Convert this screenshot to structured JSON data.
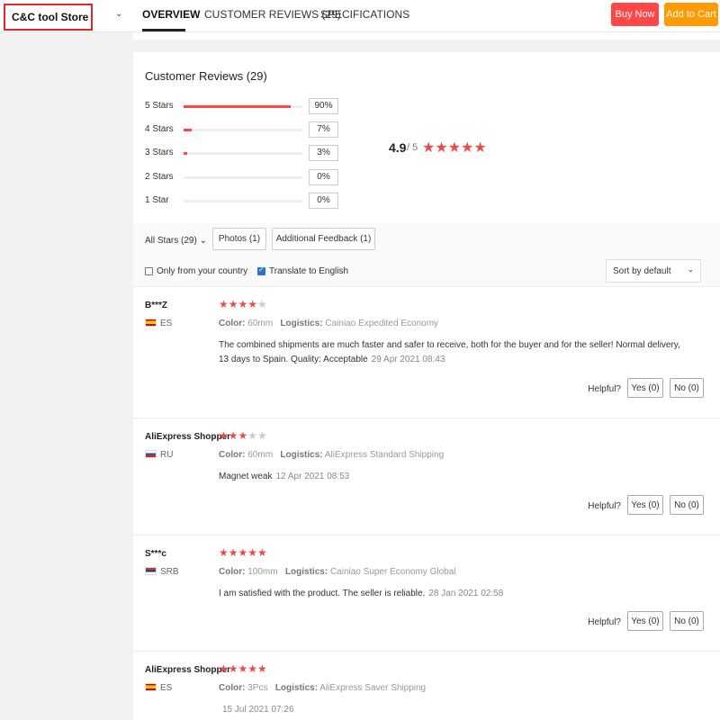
{
  "header": {
    "store_name": "C&C tool Store",
    "tabs": [
      {
        "label": "OVERVIEW"
      },
      {
        "label": "CUSTOMER REVIEWS (29)"
      },
      {
        "label": "SPECIFICATIONS"
      }
    ],
    "buy_now": "Buy Now",
    "add_to_cart": "Add to Cart",
    "colors": {
      "buy": "#ff4747",
      "cart": "#ff9a00"
    }
  },
  "summary": {
    "title": "Customer Reviews (29)",
    "rows": [
      {
        "label": "5 Stars",
        "percent": "90%",
        "fill": 0.9
      },
      {
        "label": "4 Stars",
        "percent": "7%",
        "fill": 0.07
      },
      {
        "label": "3 Stars",
        "percent": "3%",
        "fill": 0.03
      },
      {
        "label": "2 Stars",
        "percent": "0%",
        "fill": 0
      },
      {
        "label": "1 Star",
        "percent": "0%",
        "fill": 0
      }
    ],
    "score": "4.9",
    "score_max": "/ 5",
    "score_stars": "★★★★★"
  },
  "filters": {
    "all_stars": "All Stars (29)",
    "photos": "Photos (1)",
    "additional": "Additional Feedback (1)",
    "only_country": "Only from your country",
    "translate": "Translate to English",
    "sort": "Sort by default"
  },
  "reviews": [
    {
      "name": "B***Z",
      "stars_on": "★★★★",
      "stars_off": "★",
      "country": "ES",
      "color_key": "Color:",
      "color_val": "60mm",
      "log_key": "Logistics:",
      "log_val": "Cainiao Expedited Economy",
      "text": "The combined shipments are much faster and safer to receive, both for the buyer and for the seller! Normal delivery, 13 days to Spain. Quality: Acceptable",
      "date": "29 Apr 2021 08:43",
      "helpful": "Helpful?",
      "yes": "Yes (0)",
      "no": "No (0)"
    },
    {
      "name": "AliExpress Shopper",
      "stars_on": "★★★",
      "stars_off": "★★",
      "country": "RU",
      "color_key": "Color:",
      "color_val": "60mm",
      "log_key": "Logistics:",
      "log_val": "AliExpress Standard Shipping",
      "text": "Magnet weak",
      "date": "12 Apr 2021 08:53",
      "helpful": "Helpful?",
      "yes": "Yes (0)",
      "no": "No (0)"
    },
    {
      "name": "S***c",
      "stars_on": "★★★★★",
      "stars_off": "",
      "country": "SRB",
      "color_key": "Color:",
      "color_val": "100mm",
      "log_key": "Logistics:",
      "log_val": "Cainiao Super Economy Global",
      "text": "I am satisfied with the product. The seller is reliable.",
      "date": "28 Jan 2021 02:58",
      "helpful": "Helpful?",
      "yes": "Yes (0)",
      "no": "No (0)"
    },
    {
      "name": "AliExpress Shopper",
      "stars_on": "★★★★★",
      "stars_off": "",
      "country": "ES",
      "color_key": "Color:",
      "color_val": "3Pcs",
      "log_key": "Logistics:",
      "log_val": "AliExpress Saver Shipping",
      "text": "",
      "date": "15 Jul 2021 07:26"
    }
  ]
}
